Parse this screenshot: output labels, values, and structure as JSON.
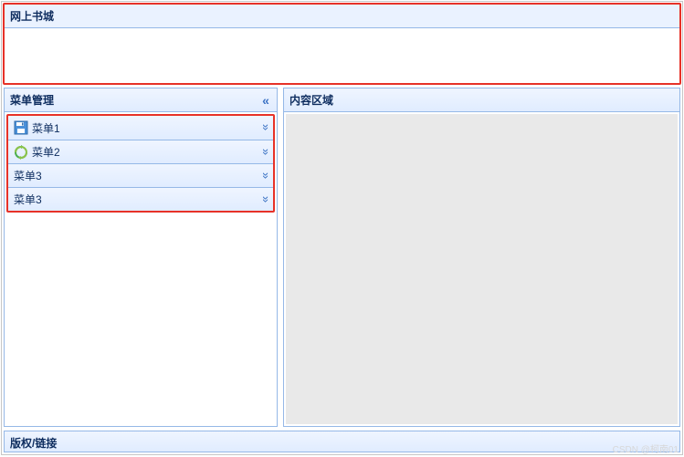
{
  "header": {
    "title": "网上书城"
  },
  "sidebar": {
    "title": "菜单管理",
    "items": [
      {
        "label": "菜单1",
        "icon": "save-icon"
      },
      {
        "label": "菜单2",
        "icon": "refresh-icon"
      },
      {
        "label": "菜单3",
        "icon": ""
      },
      {
        "label": "菜单3",
        "icon": ""
      }
    ]
  },
  "content": {
    "title": "内容区域"
  },
  "footer": {
    "title": "版权/链接"
  },
  "watermark": "CSDN @柯南01"
}
